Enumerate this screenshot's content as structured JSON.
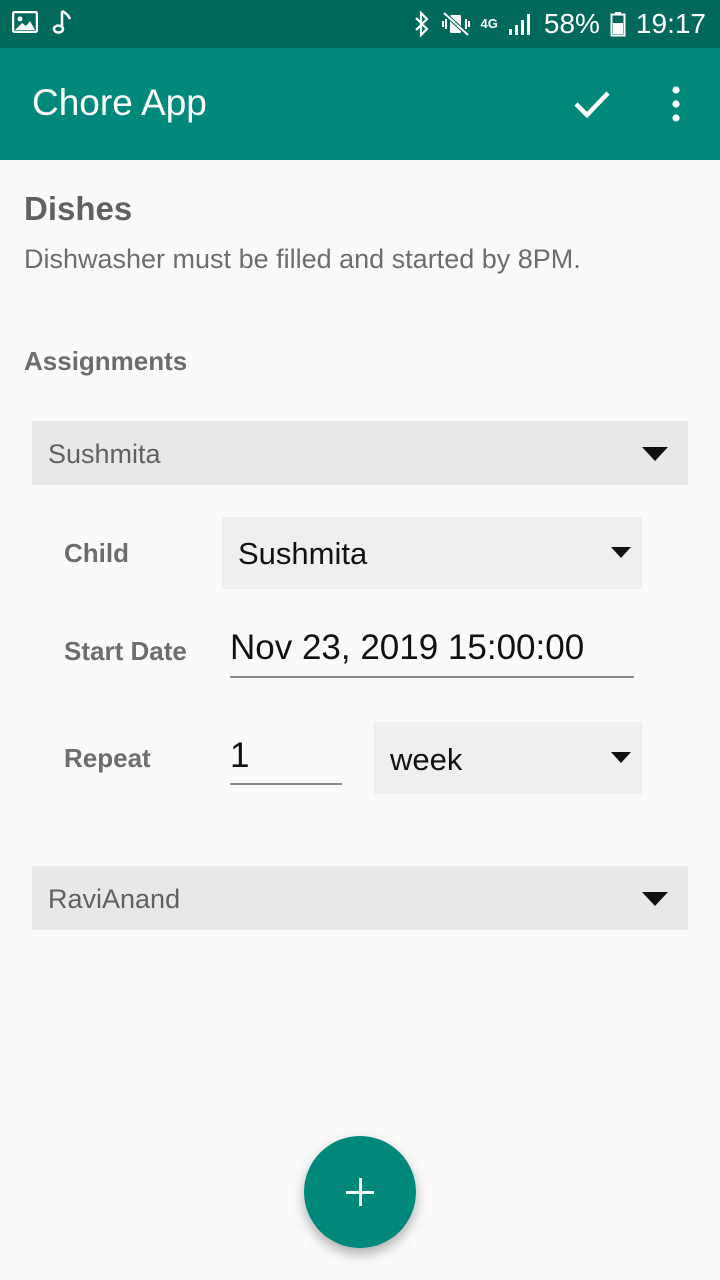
{
  "status_bar": {
    "battery": "58%",
    "time": "19:17",
    "network": "4G"
  },
  "app_bar": {
    "title": "Chore App",
    "icons": [
      "check-icon",
      "more-vert-icon"
    ]
  },
  "chore": {
    "title": "Dishes",
    "description": "Dishwasher must be filled and started by 8PM."
  },
  "assignments": {
    "label": "Assignments",
    "items": [
      {
        "name": "Sushmita",
        "expanded": true,
        "child_label": "Child",
        "child_value": "Sushmita",
        "start_date_label": "Start Date",
        "start_date_value": "Nov 23, 2019 15:00:00",
        "repeat_label": "Repeat",
        "repeat_count": "1",
        "repeat_unit": "week"
      },
      {
        "name": "RaviAnand",
        "expanded": false
      }
    ]
  },
  "fab": {
    "icon": "plus-icon"
  },
  "colors": {
    "status_bar": "#00695c",
    "app_bar": "#00897b",
    "accent": "#00897b"
  }
}
